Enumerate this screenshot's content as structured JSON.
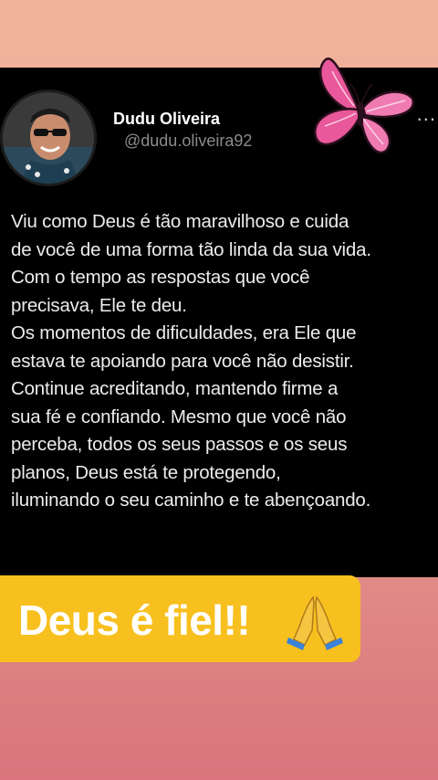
{
  "post": {
    "author_name": "Dudu Oliveira",
    "author_handle": "@dudu.oliveira92",
    "more_label": "...",
    "lines": [
      "Viu como Deus é tão maravilhoso e cuida",
      "de você de uma forma tão linda da sua vida.",
      "Com o tempo as respostas que você",
      "precisava, Ele te deu.",
      "Os momentos de dificuldades, era Ele que",
      "estava te apoiando para você não desistir.",
      "Continue acreditando, mantendo firme a",
      "sua fé e confiando. Mesmo que você não",
      "perceba, todos os seus passos e os seus",
      "planos, Deus está te protegendo,",
      "iluminando o seu caminho e te abençoando."
    ]
  },
  "banner": {
    "text": "Deus é fiel!!",
    "emoji_icon": "praying-hands-icon"
  },
  "stickers": {
    "butterfly_icon": "butterfly-icon",
    "colors": {
      "butterfly": "#e8589a",
      "banner": "#f8c01e"
    }
  }
}
